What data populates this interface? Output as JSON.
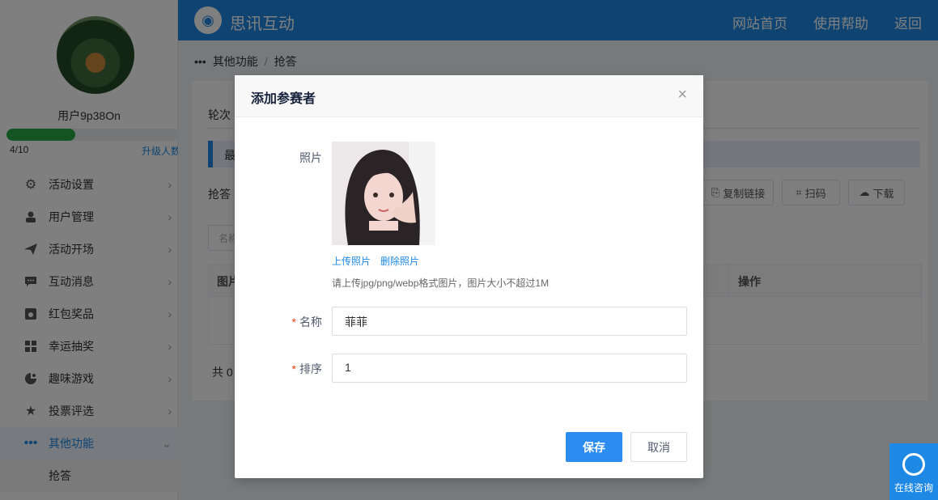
{
  "sidebar": {
    "username": "用户9p38On",
    "progress_text": "4/10",
    "progress_fraction": 0.4,
    "upgrade_label": "升级人数",
    "items": [
      {
        "label": "活动设置",
        "icon": "gear-icon"
      },
      {
        "label": "用户管理",
        "icon": "user-icon"
      },
      {
        "label": "活动开场",
        "icon": "paper-plane-icon"
      },
      {
        "label": "互动消息",
        "icon": "chat-icon"
      },
      {
        "label": "红包奖品",
        "icon": "gift-icon"
      },
      {
        "label": "幸运抽奖",
        "icon": "lottery-icon"
      },
      {
        "label": "趣味游戏",
        "icon": "game-icon"
      },
      {
        "label": "投票评选",
        "icon": "star-icon"
      },
      {
        "label": "其他功能",
        "icon": "more-icon"
      }
    ],
    "sub_item": "抢答"
  },
  "header": {
    "logo_text": "思讯互动",
    "nav": [
      "网站首页",
      "使用帮助",
      "返回"
    ]
  },
  "breadcrumb": {
    "root": "其他功能",
    "sep": "/",
    "current": "抢答"
  },
  "background": {
    "tab": "轮次",
    "alert": "最",
    "row_label": "抢答",
    "buttons": [
      "复制链接",
      "扫码",
      "下载"
    ],
    "search_placeholder": "名称",
    "table_headers": [
      "图片",
      "操作"
    ],
    "total": "共 0"
  },
  "modal": {
    "title": "添加参赛者",
    "close": "×",
    "photo_label": "照片",
    "upload_link": "上传照片",
    "delete_link": "删除照片",
    "hint": "请上传jpg/png/webp格式图片，图片大小不超过1M",
    "name_label": "名称",
    "name_value": "菲菲",
    "order_label": "排序",
    "order_value": "1",
    "required_mark": "*",
    "save": "保存",
    "cancel": "取消"
  },
  "service": {
    "label": "在线咨询"
  },
  "colors": {
    "primary": "#1e88e5",
    "progress": "#27a844",
    "save_button": "#2d8cf0",
    "required": "#ed4014"
  }
}
